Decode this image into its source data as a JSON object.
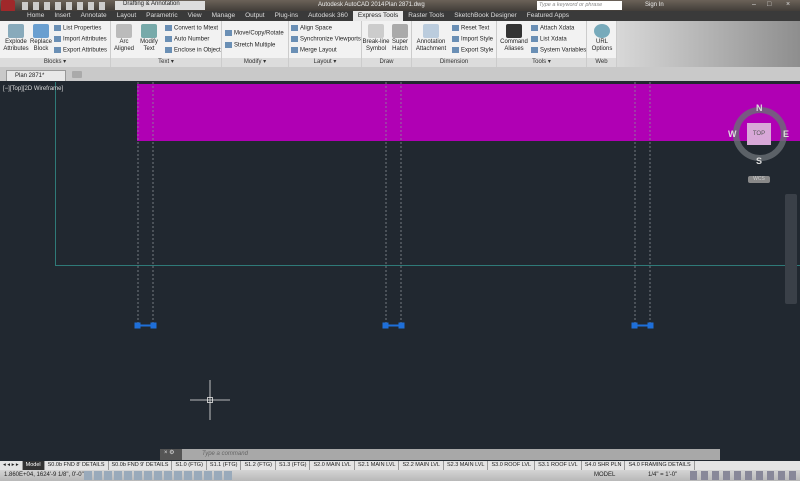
{
  "title": {
    "workspace": "Drafting & Annotation",
    "app": "Autodesk AutoCAD 2014",
    "file": "Plan 2871.dwg",
    "search_placeholder": "Type a keyword or phrase",
    "sign_in": "Sign In"
  },
  "ribbon_tabs": [
    "Home",
    "Insert",
    "Annotate",
    "Layout",
    "Parametric",
    "View",
    "Manage",
    "Output",
    "Plug-ins",
    "Autodesk 360",
    "Express Tools",
    "Raster Tools",
    "SketchBook Designer",
    "Featured Apps"
  ],
  "panels": {
    "blocks": {
      "label": "Blocks ▾",
      "explode": "Explode Attributes",
      "replace": "Replace Block",
      "list": "List Properties",
      "import": "Import Attributes",
      "export": "Export Attributes"
    },
    "text": {
      "label": "Text ▾",
      "arc": "Arc Aligned",
      "modify": "Modify Text",
      "convert": "Convert to Mtext",
      "auto": "Auto Number",
      "enclose": "Enclose in Object"
    },
    "modify": {
      "label": "Modify ▾",
      "move": "Move/Copy/Rotate",
      "stretch": "Stretch Multiple"
    },
    "layout": {
      "label": "Layout ▾",
      "align": "Align Space",
      "sync": "Synchronize Viewports",
      "merge": "Merge Layout"
    },
    "draw": {
      "label": "Draw",
      "breakline": "Break-line Symbol",
      "hatch": "Super Hatch"
    },
    "dimension": {
      "label": "Dimension",
      "attach": "Annotation Attachment",
      "reset": "Reset Text",
      "import": "Import Style",
      "export": "Export Style"
    },
    "tools": {
      "label": "Tools ▾",
      "cmd": "Command Aliases",
      "attach": "Attach Xdata",
      "list": "List Xdata",
      "sysvar": "System Variables"
    },
    "web": {
      "label": "Web",
      "url": "URL Options"
    }
  },
  "doc_tab": "Plan 2871*",
  "viewport_label": "[−][Top][2D Wireframe]",
  "viewcube": {
    "n": "N",
    "s": "S",
    "e": "E",
    "w": "W",
    "top": "TOP",
    "wcs": "WCS"
  },
  "command_placeholder": "Type a command",
  "layout_tabs": [
    "Model",
    "S0.0b FND 8' DETAILS",
    "S0.0b FND 9' DETAILS",
    "S1.0 (FTG)",
    "S1.1 (FTG)",
    "S1.2 (FTG)",
    "S1.3 (FTG)",
    "S2.0 MAIN LVL",
    "S2.1 MAIN LVL",
    "S2.2 MAIN LVL",
    "S2.3 MAIN LVL",
    "S3.0 ROOF LVL",
    "S3.1 ROOF LVL",
    "S4.0 SHR PLN",
    "S4.0 FRAMING DETAILS"
  ],
  "status": {
    "coords": "1.860E+04,  1624'-9 1/8\", 0'-0\"",
    "model": "MODEL",
    "scale": "1/4\" = 1'-0\""
  },
  "colors": {
    "magenta": "#b000b4",
    "canvas": "#212830",
    "teal": "#2f7a78",
    "grip": "#1e6fd9"
  }
}
